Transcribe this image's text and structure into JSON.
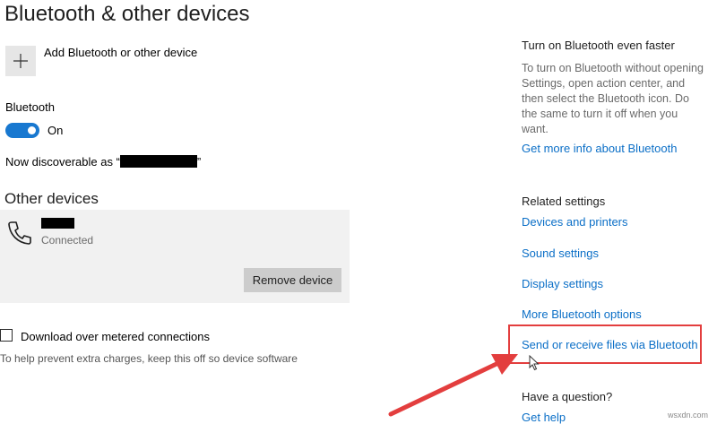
{
  "page": {
    "title": "Bluetooth & other devices"
  },
  "main": {
    "add_device_label": "Add Bluetooth or other device",
    "bluetooth_label": "Bluetooth",
    "toggle_state": "On",
    "discoverable_prefix": "Now discoverable as “",
    "discoverable_suffix": "”",
    "other_devices_title": "Other devices",
    "device": {
      "status": "Connected",
      "remove_label": "Remove device"
    },
    "metered_label": "Download over metered connections",
    "metered_help": "To help prevent extra charges, keep this off so device software"
  },
  "sidebar": {
    "faster_heading": "Turn on Bluetooth even faster",
    "faster_body": "To turn on Bluetooth without opening Settings, open action center, and then select the Bluetooth icon. Do the same to turn it off when you want.",
    "more_info_link": "Get more info about Bluetooth",
    "related_heading": "Related settings",
    "related_links": [
      "Devices and printers",
      "Sound settings",
      "Display settings",
      "More Bluetooth options",
      "Send or receive files via Bluetooth"
    ],
    "question_heading": "Have a question?",
    "get_help_link": "Get help"
  },
  "watermark": "wsxdn.com",
  "colors": {
    "accent": "#0b6fc7",
    "toggle_on": "#1878d0",
    "annotation_red": "#e33e3e"
  },
  "icons": [
    "plus-icon",
    "phone-icon",
    "cursor-icon",
    "arrow-annotation"
  ]
}
